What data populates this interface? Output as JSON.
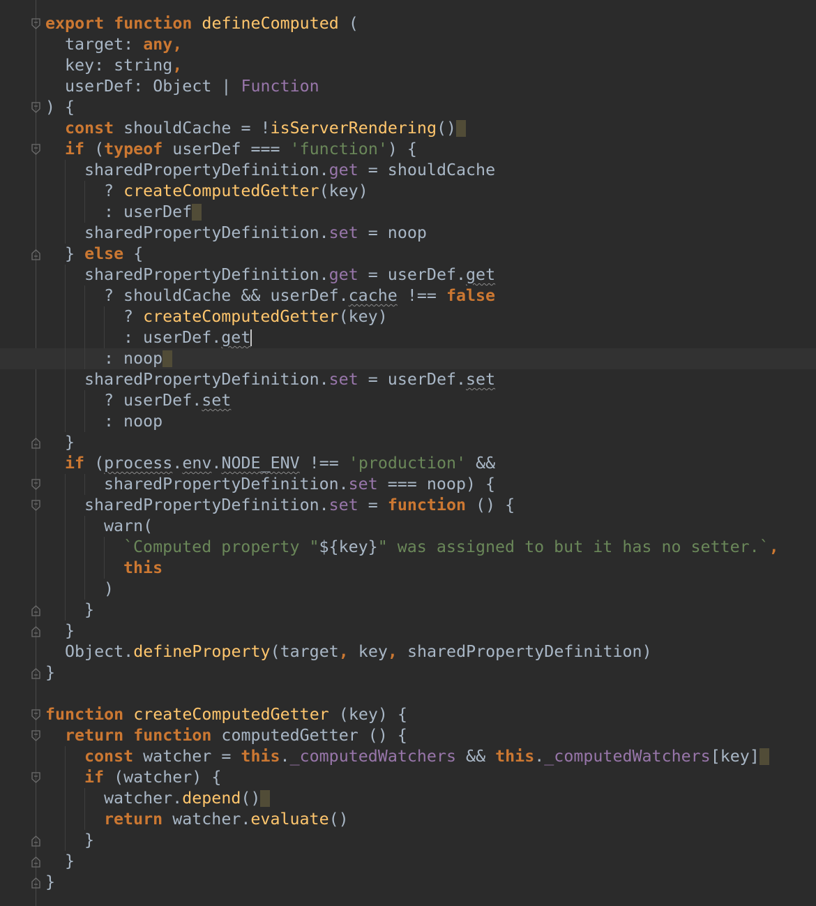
{
  "editor": {
    "colors": {
      "background": "#2b2b2b",
      "current_line": "#323232",
      "plain": "#a9b7c6",
      "keyword": "#cc7832",
      "function_name": "#ffc66d",
      "property": "#9876aa",
      "string": "#6a8759",
      "bracket_highlight": "#514c37",
      "squiggle": "#8a8a8a"
    },
    "current_line": 16,
    "lines": [
      {
        "indent": 0,
        "fold": "open",
        "tokens": [
          [
            "kw",
            "export "
          ],
          [
            "kw",
            "function "
          ],
          [
            "fn",
            "defineComputed"
          ],
          [
            "p",
            " ("
          ]
        ]
      },
      {
        "indent": 1,
        "fold": "",
        "tokens": [
          [
            "p",
            "target: "
          ],
          [
            "kw",
            "any,"
          ]
        ]
      },
      {
        "indent": 1,
        "fold": "",
        "tokens": [
          [
            "p",
            "key: string"
          ],
          [
            "kw",
            ","
          ]
        ]
      },
      {
        "indent": 1,
        "fold": "",
        "tokens": [
          [
            "p",
            "userDef: Object | "
          ],
          [
            "prop",
            "Function"
          ]
        ]
      },
      {
        "indent": 0,
        "fold": "open",
        "tokens": [
          [
            "p",
            ") {"
          ]
        ]
      },
      {
        "indent": 1,
        "fold": "",
        "tokens": [
          [
            "kw",
            "const "
          ],
          [
            "p",
            "shouldCache = !"
          ],
          [
            "fn",
            "isServerRendering"
          ],
          [
            "p",
            "()"
          ],
          [
            "caret",
            ""
          ]
        ]
      },
      {
        "indent": 1,
        "fold": "open",
        "tokens": [
          [
            "kw",
            "if "
          ],
          [
            "p",
            "("
          ],
          [
            "kw",
            "typeof "
          ],
          [
            "p",
            "userDef === "
          ],
          [
            "str",
            "'function'"
          ],
          [
            "p",
            ") {"
          ]
        ]
      },
      {
        "indent": 2,
        "fold": "",
        "tokens": [
          [
            "p",
            "sharedPropertyDefinition."
          ],
          [
            "prop",
            "get"
          ],
          [
            "p",
            " = shouldCache"
          ]
        ]
      },
      {
        "indent": 3,
        "fold": "",
        "tokens": [
          [
            "p",
            "? "
          ],
          [
            "fn",
            "createComputedGetter"
          ],
          [
            "p",
            "(key)"
          ]
        ]
      },
      {
        "indent": 3,
        "fold": "",
        "tokens": [
          [
            "p",
            ": userDef"
          ],
          [
            "caret",
            ""
          ]
        ]
      },
      {
        "indent": 2,
        "fold": "",
        "tokens": [
          [
            "p",
            "sharedPropertyDefinition."
          ],
          [
            "prop",
            "set"
          ],
          [
            "p",
            " = noop"
          ]
        ]
      },
      {
        "indent": 1,
        "fold": "close",
        "tokens": [
          [
            "p",
            "} "
          ],
          [
            "kw",
            "else "
          ],
          [
            "p",
            "{"
          ]
        ]
      },
      {
        "indent": 2,
        "fold": "",
        "tokens": [
          [
            "p",
            "sharedPropertyDefinition."
          ],
          [
            "prop",
            "get"
          ],
          [
            "p",
            " = userDef."
          ],
          [
            "sq",
            "get"
          ]
        ]
      },
      {
        "indent": 3,
        "fold": "",
        "tokens": [
          [
            "p",
            "? shouldCache && userDef."
          ],
          [
            "sq",
            "cache"
          ],
          [
            "p",
            " !== "
          ],
          [
            "kw",
            "false"
          ]
        ]
      },
      {
        "indent": 4,
        "fold": "",
        "tokens": [
          [
            "p",
            "? "
          ],
          [
            "fn",
            "createComputedGetter"
          ],
          [
            "p",
            "(key)"
          ]
        ]
      },
      {
        "indent": 4,
        "fold": "",
        "tokens": [
          [
            "p",
            ": userDef."
          ],
          [
            "sq",
            "get"
          ],
          [
            "cursor",
            ""
          ]
        ]
      },
      {
        "indent": 3,
        "fold": "",
        "tokens": [
          [
            "p",
            ": noop"
          ],
          [
            "caret",
            ""
          ]
        ]
      },
      {
        "indent": 2,
        "fold": "",
        "tokens": [
          [
            "p",
            "sharedPropertyDefinition."
          ],
          [
            "prop",
            "set"
          ],
          [
            "p",
            " = userDef."
          ],
          [
            "sq",
            "set"
          ]
        ]
      },
      {
        "indent": 3,
        "fold": "",
        "tokens": [
          [
            "p",
            "? userDef."
          ],
          [
            "sq",
            "set"
          ]
        ]
      },
      {
        "indent": 3,
        "fold": "",
        "tokens": [
          [
            "p",
            ": noop"
          ]
        ]
      },
      {
        "indent": 1,
        "fold": "close",
        "tokens": [
          [
            "p",
            "}"
          ]
        ]
      },
      {
        "indent": 1,
        "fold": "",
        "tokens": [
          [
            "kw",
            "if "
          ],
          [
            "p",
            "("
          ],
          [
            "sq",
            "process"
          ],
          [
            "p",
            "."
          ],
          [
            "sq",
            "env"
          ],
          [
            "p",
            "."
          ],
          [
            "sq",
            "NODE_ENV"
          ],
          [
            "p",
            " !== "
          ],
          [
            "str",
            "'production'"
          ],
          [
            "p",
            " &&"
          ]
        ]
      },
      {
        "indent": 3,
        "fold": "open",
        "tokens": [
          [
            "p",
            "sharedPropertyDefinition."
          ],
          [
            "prop",
            "set"
          ],
          [
            "p",
            " === noop) {"
          ]
        ]
      },
      {
        "indent": 2,
        "fold": "open",
        "tokens": [
          [
            "p",
            "sharedPropertyDefinition."
          ],
          [
            "prop",
            "set"
          ],
          [
            "p",
            " = "
          ],
          [
            "kw",
            "function "
          ],
          [
            "p",
            "() {"
          ]
        ]
      },
      {
        "indent": 3,
        "fold": "",
        "tokens": [
          [
            "p",
            "warn("
          ]
        ]
      },
      {
        "indent": 4,
        "fold": "",
        "tokens": [
          [
            "str",
            "`Computed property \""
          ],
          [
            "p",
            "${key}"
          ],
          [
            "str",
            "\" was assigned to but it has no setter.`"
          ],
          [
            "kw",
            ","
          ]
        ]
      },
      {
        "indent": 4,
        "fold": "",
        "tokens": [
          [
            "kw",
            "this"
          ]
        ]
      },
      {
        "indent": 3,
        "fold": "",
        "tokens": [
          [
            "p",
            ")"
          ]
        ]
      },
      {
        "indent": 2,
        "fold": "close",
        "tokens": [
          [
            "p",
            "}"
          ]
        ]
      },
      {
        "indent": 1,
        "fold": "close",
        "tokens": [
          [
            "p",
            "}"
          ]
        ]
      },
      {
        "indent": 1,
        "fold": "",
        "tokens": [
          [
            "p",
            "Object."
          ],
          [
            "fn",
            "defineProperty"
          ],
          [
            "p",
            "(target"
          ],
          [
            "kw",
            ","
          ],
          [
            "p",
            " key"
          ],
          [
            "kw",
            ","
          ],
          [
            "p",
            " sharedPropertyDefinition)"
          ]
        ]
      },
      {
        "indent": 0,
        "fold": "close",
        "tokens": [
          [
            "p",
            "}"
          ]
        ]
      },
      {
        "indent": 0,
        "fold": "",
        "tokens": []
      },
      {
        "indent": 0,
        "fold": "open",
        "tokens": [
          [
            "kw",
            "function "
          ],
          [
            "fn",
            "createComputedGetter"
          ],
          [
            "p",
            " (key) {"
          ]
        ]
      },
      {
        "indent": 1,
        "fold": "open",
        "tokens": [
          [
            "kw",
            "return "
          ],
          [
            "kw",
            "function "
          ],
          [
            "p",
            "computedGetter () {"
          ]
        ]
      },
      {
        "indent": 2,
        "fold": "",
        "tokens": [
          [
            "kw",
            "const "
          ],
          [
            "p",
            "watcher = "
          ],
          [
            "kw",
            "this"
          ],
          [
            "p",
            "."
          ],
          [
            "prop",
            "_computedWatchers"
          ],
          [
            "p",
            " && "
          ],
          [
            "kw",
            "this"
          ],
          [
            "p",
            "."
          ],
          [
            "prop",
            "_computedWatchers"
          ],
          [
            "p",
            "[key]"
          ],
          [
            "caret",
            ""
          ]
        ]
      },
      {
        "indent": 2,
        "fold": "open",
        "tokens": [
          [
            "kw",
            "if "
          ],
          [
            "p",
            "(watcher) {"
          ]
        ]
      },
      {
        "indent": 3,
        "fold": "",
        "tokens": [
          [
            "p",
            "watcher."
          ],
          [
            "fn",
            "depend"
          ],
          [
            "p",
            "()"
          ],
          [
            "caret",
            ""
          ]
        ]
      },
      {
        "indent": 3,
        "fold": "",
        "tokens": [
          [
            "kw",
            "return "
          ],
          [
            "p",
            "watcher."
          ],
          [
            "fn",
            "evaluate"
          ],
          [
            "p",
            "()"
          ]
        ]
      },
      {
        "indent": 2,
        "fold": "close",
        "tokens": [
          [
            "p",
            "}"
          ]
        ]
      },
      {
        "indent": 1,
        "fold": "close",
        "tokens": [
          [
            "p",
            "}"
          ]
        ]
      },
      {
        "indent": 0,
        "fold": "close",
        "tokens": [
          [
            "p",
            "}"
          ]
        ]
      }
    ]
  }
}
